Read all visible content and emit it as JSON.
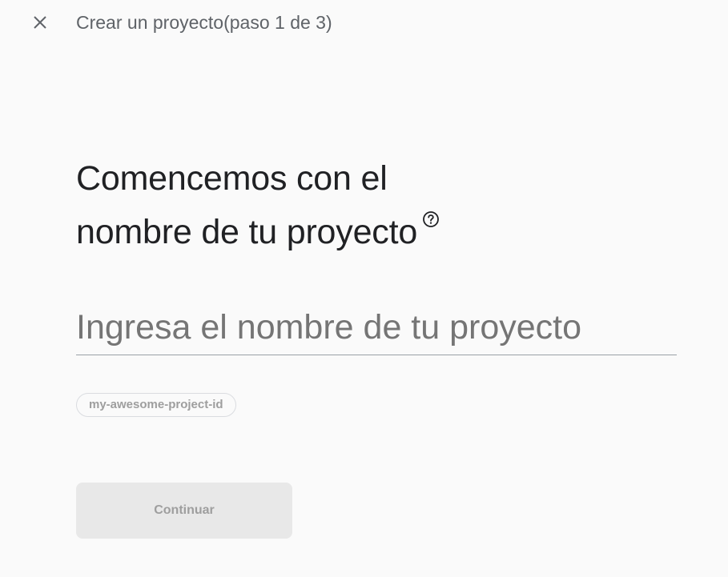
{
  "header": {
    "close_icon": "close-icon",
    "title": "Crear un proyecto(paso 1 de 3)"
  },
  "main": {
    "heading_line1": "Comencemos con el",
    "heading_line2": "nombre de tu proyecto",
    "help_icon": "help-circle-icon",
    "name_input": {
      "value": "",
      "placeholder": "Ingresa el nombre de tu proyecto"
    },
    "project_id": "my-awesome-project-id",
    "continue_label": "Continuar"
  },
  "colors": {
    "background": "#fafafa",
    "heading_text": "#202124",
    "secondary_text": "#5f6368",
    "disabled_button_bg": "#e8e8e8",
    "disabled_text": "#9e9e9e"
  }
}
